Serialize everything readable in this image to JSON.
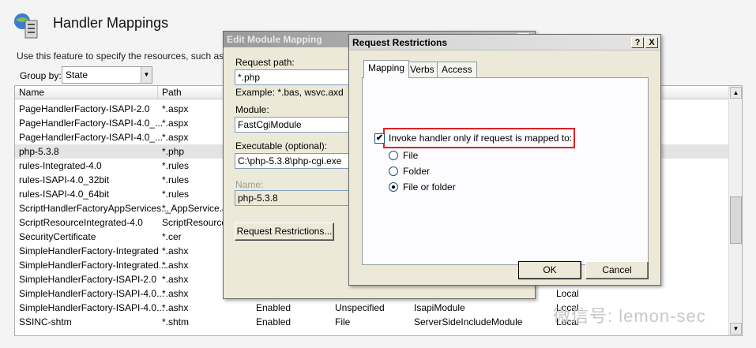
{
  "page": {
    "title": "Handler Mappings",
    "description": "Use this feature to specify the resources, such as DLLs",
    "groupby_label": "Group by:",
    "groupby_value": "State",
    "columns": [
      "Name",
      "Path"
    ],
    "rows": [
      {
        "name": "PageHandlerFactory-ISAPI-2.0",
        "path": "*.aspx",
        "state": "",
        "path_type": "",
        "handler": ""
      },
      {
        "name": "PageHandlerFactory-ISAPI-4.0_...",
        "path": "*.aspx",
        "state": "",
        "path_type": "",
        "handler": ""
      },
      {
        "name": "PageHandlerFactory-ISAPI-4.0_...",
        "path": "*.aspx",
        "state": "",
        "path_type": "",
        "handler": ""
      },
      {
        "name": "php-5.3.8",
        "path": "*.php",
        "state": "",
        "path_type": "",
        "handler": ""
      },
      {
        "name": "rules-Integrated-4.0",
        "path": "*.rules",
        "state": "",
        "path_type": "",
        "handler": ""
      },
      {
        "name": "rules-ISAPI-4.0_32bit",
        "path": "*.rules",
        "state": "",
        "path_type": "",
        "handler": ""
      },
      {
        "name": "rules-ISAPI-4.0_64bit",
        "path": "*.rules",
        "state": "",
        "path_type": "",
        "handler": ""
      },
      {
        "name": "ScriptHandlerFactoryAppServices...",
        "path": "*_AppService.a",
        "state": "",
        "path_type": "",
        "handler": ""
      },
      {
        "name": "ScriptResourceIntegrated-4.0",
        "path": "ScriptResource.",
        "state": "",
        "path_type": "",
        "handler": ""
      },
      {
        "name": "SecurityCertificate",
        "path": "*.cer",
        "state": "",
        "path_type": "",
        "handler": ""
      },
      {
        "name": "SimpleHandlerFactory-Integrated",
        "path": "*.ashx",
        "state": "",
        "path_type": "",
        "handler": ""
      },
      {
        "name": "SimpleHandlerFactory-Integrated...",
        "path": "*.ashx",
        "state": "",
        "path_type": "",
        "handler": ""
      },
      {
        "name": "SimpleHandlerFactory-ISAPI-2.0",
        "path": "*.ashx",
        "state": "",
        "path_type": "",
        "handler": ""
      },
      {
        "name": "SimpleHandlerFactory-ISAPI-4.0...",
        "path": "*.ashx",
        "state": "",
        "path_type": "",
        "handler": "Local"
      },
      {
        "name": "SimpleHandlerFactory-ISAPI-4.0...",
        "path": "*.ashx",
        "state": "Enabled",
        "path_type": "Unspecified",
        "handler": "IsapiModule",
        "entry": "Local"
      },
      {
        "name": "SSINC-shtm",
        "path": "*.shtm",
        "state": "Enabled",
        "path_type": "File",
        "handler": "ServerSideIncludeModule",
        "entry": "Local"
      }
    ]
  },
  "edit_dialog": {
    "title": "Edit Module Mapping",
    "request_path_label": "Request path:",
    "request_path_value": "*.php",
    "example": "Example: *.bas, wsvc.axd",
    "module_label": "Module:",
    "module_value": "FastCgiModule",
    "executable_label": "Executable (optional):",
    "executable_value": "C:\\php-5.3.8\\php-cgi.exe",
    "name_label": "Name:",
    "name_value": "php-5.3.8",
    "request_restrictions_button": "Request Restrictions..."
  },
  "restrictions_dialog": {
    "title": "Request Restrictions",
    "help_button": "?",
    "close_button": "X",
    "tabs": [
      "Mapping",
      "Verbs",
      "Access"
    ],
    "invoke_checkbox_label": "Invoke handler only if request is mapped to:",
    "invoke_checked": true,
    "options": [
      "File",
      "Folder",
      "File or folder"
    ],
    "selected_option": "File or folder",
    "ok_button": "OK",
    "cancel_button": "Cancel"
  },
  "watermark": "微信号: lemon-sec"
}
